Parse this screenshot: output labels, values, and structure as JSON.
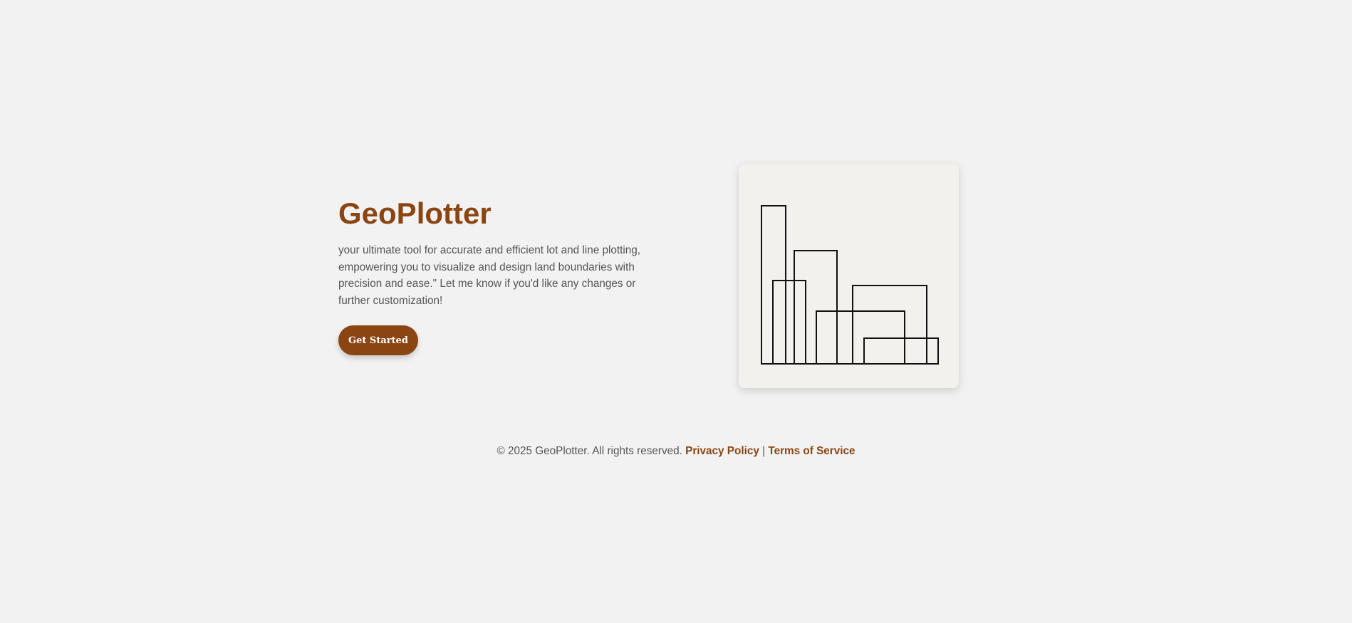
{
  "hero": {
    "title": "GeoPlotter",
    "description": "your ultimate tool for accurate and efficient lot and line plotting, empowering you to visualize and design land boundaries with precision and ease.\" Let me know if you'd like any changes or further customization!",
    "cta_label": "Get Started"
  },
  "illustration": {
    "icon": "building-outline-illustration"
  },
  "footer": {
    "copyright": "© 2025 GeoPlotter. All rights reserved.",
    "privacy_label": "Privacy Policy",
    "separator": "|",
    "terms_label": "Terms of Service"
  },
  "colors": {
    "accent": "#8b4513",
    "background": "#f2f2f2",
    "card": "#f3f1ed",
    "text": "#555555"
  }
}
